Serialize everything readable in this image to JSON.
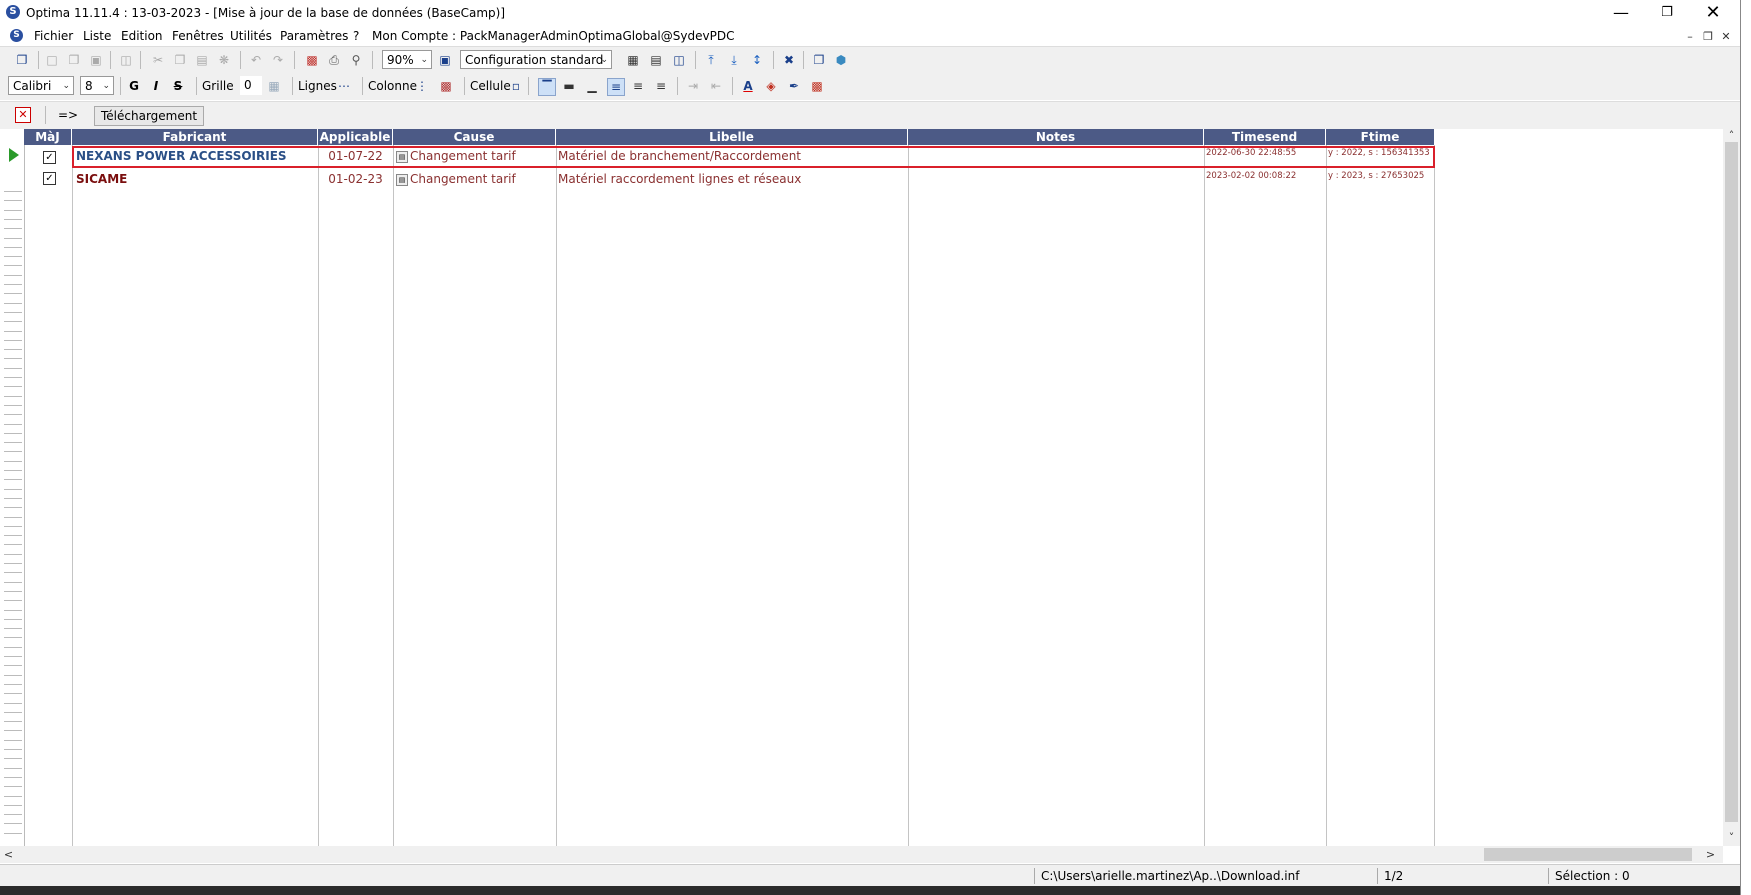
{
  "window": {
    "title": "Optima 11.11.4 : 13-03-2023 - [Mise à jour de la base de données (BaseCamp)]",
    "app_icon": "optima-logo-icon",
    "controls": [
      "minimize-icon",
      "restore-icon",
      "close-icon"
    ]
  },
  "menu": {
    "items": [
      "Fichier",
      "Liste",
      "Edition",
      "Fenêtres",
      "Utilités",
      "Paramètres",
      "?",
      "Mon Compte : PackManagerAdminOptimaGlobal@SydevPDC"
    ]
  },
  "toolbar1": {
    "zoom": "90%",
    "configuration": "Configuration standard"
  },
  "toolbar2": {
    "font": "Calibri",
    "size": "8",
    "bold": "G",
    "italic": "I",
    "strike": "S",
    "grille_label": "Grille",
    "grille_value": "0",
    "lignes_label": "Lignes",
    "colonne_label": "Colonne",
    "cellule_label": "Cellule"
  },
  "toolbar3": {
    "arrow": "=>",
    "download_button": "Téléchargement"
  },
  "grid": {
    "columns": [
      "MàJ",
      "Fabricant",
      "Applicable",
      "Cause",
      "Libelle",
      "Notes",
      "Timesend",
      "Ftime"
    ],
    "rows": [
      {
        "maj": "✓",
        "fabricant": "NEXANS POWER ACCESSOIRIES",
        "applicable": "01-07-22",
        "cause": "Changement tarif",
        "libelle": "Matériel de branchement/Raccordement",
        "notes": "",
        "timesend": "2022-06-30 22:48:55",
        "ftime": "y : 2022, s : 156341353",
        "selected": true
      },
      {
        "maj": "✓",
        "fabricant": "SICAME",
        "applicable": "01-02-23",
        "cause": "Changement tarif",
        "libelle": "Matériel raccordement lignes et réseaux",
        "notes": "",
        "timesend": "2023-02-02 00:08:22",
        "ftime": "y : 2023, s : 27653025",
        "selected": false
      }
    ]
  },
  "status": {
    "path": "C:\\Users\\arielle.martinez\\Ap..\\Download.inf",
    "page": "1/2",
    "selection": "Sélection : 0"
  },
  "colors": {
    "header_bg": "#4c5a86",
    "fabricant_selected": "#2a4f86",
    "fabricant_normal": "#7a0e0e",
    "row_text": "#8a3030",
    "selection_border": "#d9202b"
  }
}
